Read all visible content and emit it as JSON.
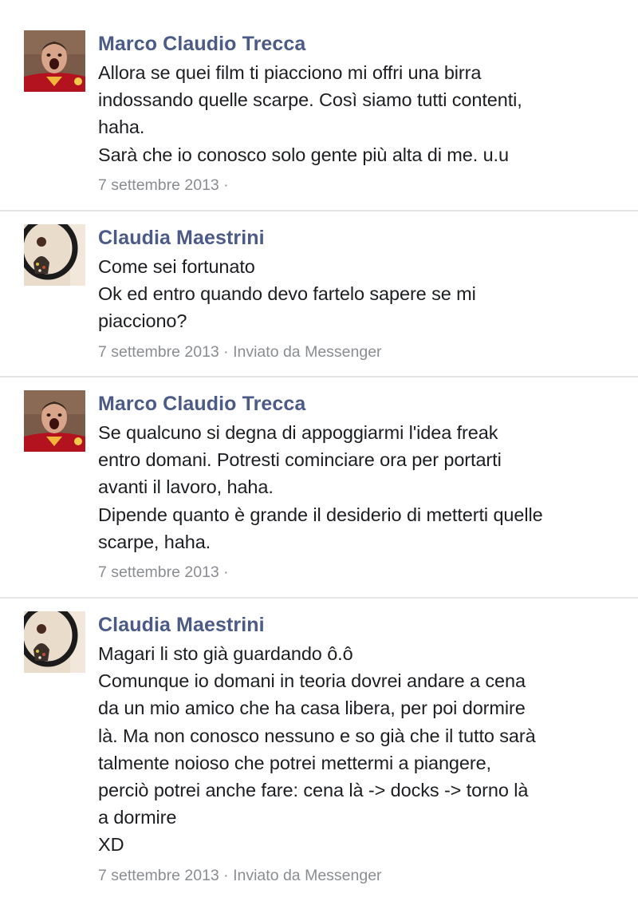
{
  "messages": [
    {
      "sender": "Marco Claudio Trecca",
      "avatar_icon": "avatar-marco-trecca",
      "lines": [
        "Allora se quei film ti piacciono mi offri una birra",
        "indossando quelle scarpe. Così siamo tutti contenti,",
        "haha.",
        "Sarà che io conosco solo gente più alta di me. u.u"
      ],
      "meta": "7 settembre 2013 ·"
    },
    {
      "sender": "Claudia Maestrini",
      "avatar_icon": "avatar-claudia-maestrini",
      "lines": [
        "Come sei fortunato",
        "Ok ed entro quando devo fartelo sapere se mi",
        "piacciono?"
      ],
      "meta": "7 settembre 2013 · Inviato da Messenger"
    },
    {
      "sender": "Marco Claudio Trecca",
      "avatar_icon": "avatar-marco-trecca",
      "lines": [
        "Se qualcuno si degna di appoggiarmi l'idea freak",
        "entro domani. Potresti cominciare ora per portarti",
        "avanti il lavoro, haha.",
        "Dipende quanto è grande il desiderio di metterti quelle",
        "scarpe, haha."
      ],
      "meta": "7 settembre 2013 ·"
    },
    {
      "sender": "Claudia Maestrini",
      "avatar_icon": "avatar-claudia-maestrini",
      "lines": [
        "Magari li sto già guardando ô.ô",
        "Comunque io domani in teoria dovrei andare a cena",
        "da un mio amico che ha casa libera, per poi dormire",
        "là. Ma non conosco nessuno e so già che il tutto sarà",
        "talmente noioso che potrei mettermi a piangere,",
        "perciò potrei anche fare: cena là -> docks -> torno là",
        "a dormire",
        "XD"
      ],
      "meta": "7 settembre 2013 · Inviato da Messenger"
    }
  ],
  "colors": {
    "sender_name": "#4b5a87",
    "message_text": "#1c1e21",
    "meta_text": "#8a8d91",
    "divider": "#e3e5e9"
  }
}
